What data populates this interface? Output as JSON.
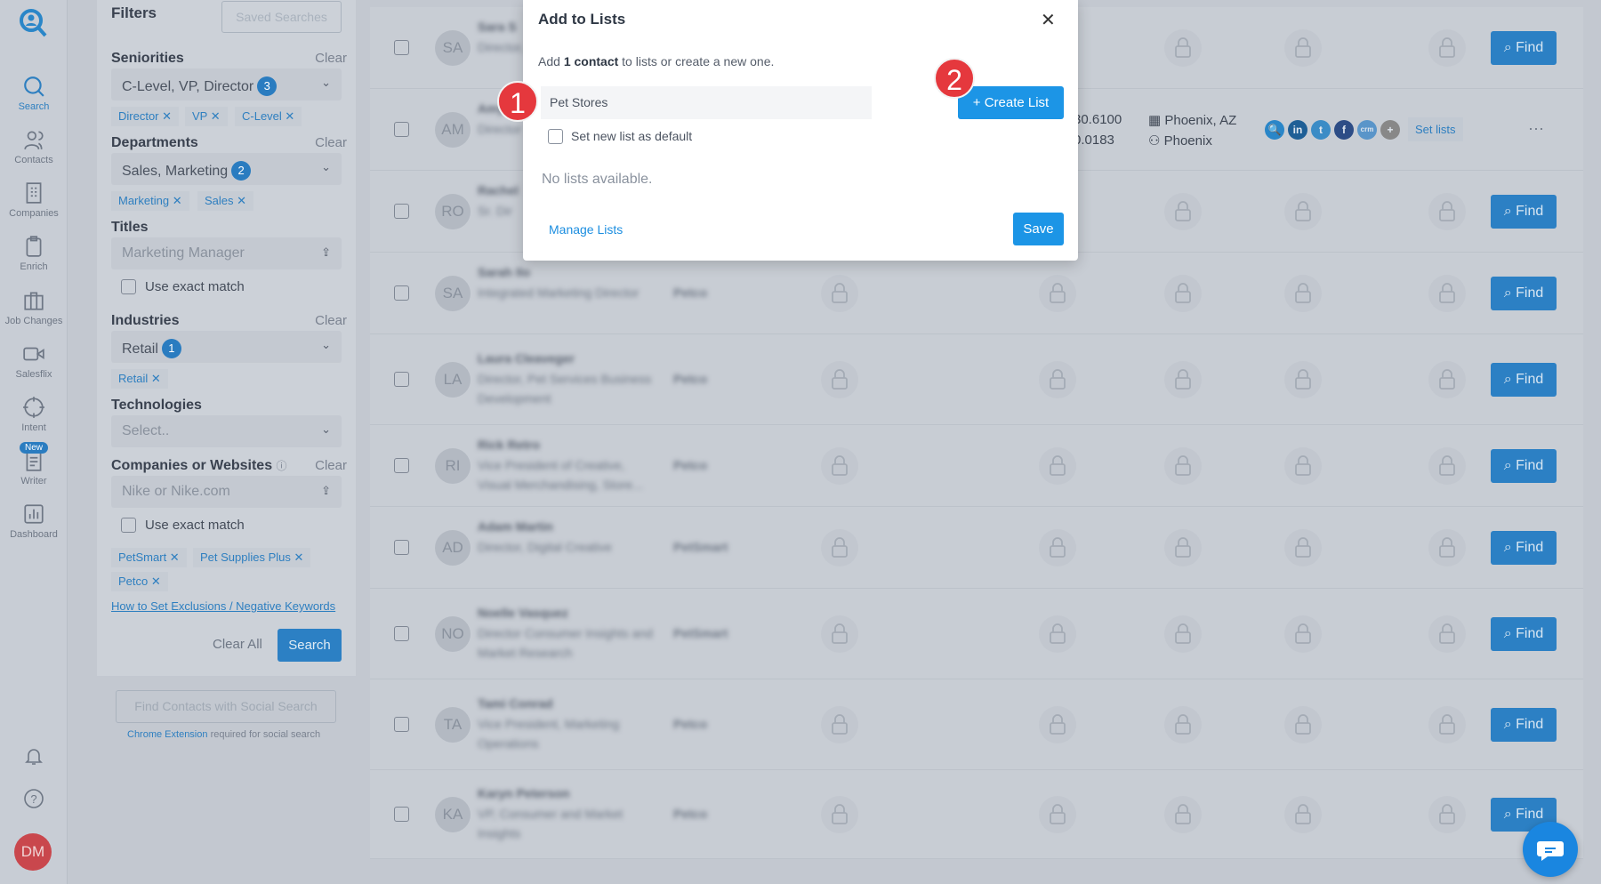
{
  "nav": {
    "items": [
      {
        "label": "Search",
        "icon": "search-icon"
      },
      {
        "label": "Contacts",
        "icon": "contacts-icon"
      },
      {
        "label": "Companies",
        "icon": "building-icon"
      },
      {
        "label": "Enrich",
        "icon": "clipboard-icon"
      },
      {
        "label": "Job Changes",
        "icon": "briefcase-icon"
      },
      {
        "label": "Salesflix",
        "icon": "video-icon"
      },
      {
        "label": "Intent",
        "icon": "crosshair-icon"
      },
      {
        "label": "Writer",
        "icon": "document-icon",
        "badge": "New"
      },
      {
        "label": "Dashboard",
        "icon": "chart-icon"
      }
    ],
    "avatar": "DM"
  },
  "filters": {
    "title": "Filters",
    "saved_searches": "Saved Searches",
    "clear": "Clear",
    "seniorities": {
      "label": "Seniorities",
      "value": "C-Level, VP, Director",
      "count": "3",
      "tags": [
        "Director",
        "VP",
        "C-Level"
      ]
    },
    "departments": {
      "label": "Departments",
      "value": "Sales, Marketing",
      "count": "2",
      "tags": [
        "Marketing",
        "Sales"
      ]
    },
    "titles": {
      "label": "Titles",
      "placeholder": "Marketing Manager",
      "exact": "Use exact match"
    },
    "industries": {
      "label": "Industries",
      "value": "Retail",
      "count": "1",
      "tags": [
        "Retail"
      ]
    },
    "technologies": {
      "label": "Technologies",
      "placeholder": "Select.."
    },
    "companies": {
      "label": "Companies or Websites",
      "placeholder": "Nike or Nike.com",
      "exact": "Use exact match",
      "tags": [
        "PetSmart",
        "Pet Supplies Plus",
        "Petco"
      ]
    },
    "exclusions_link": "How to Set Exclusions / Negative Keywords",
    "clear_all": "Clear All",
    "search": "Search",
    "social_search": "Find Contacts with Social Search",
    "chrome_ext": "Chrome Extension",
    "chrome_note": "required for social search"
  },
  "rows": [
    {
      "initials": "SA",
      "name": "Sara S",
      "title": "Director, ...",
      "company": ""
    },
    {
      "initials": "AM",
      "name": "Amy",
      "title": "Director",
      "company": "",
      "phone1": "30.6100",
      "phone2": "0.0183",
      "location1": "Phoenix, AZ",
      "location2": "Phoenix",
      "set_lists": "Set lists",
      "more": "···"
    },
    {
      "initials": "RO",
      "name": "Rachel",
      "title": "Sr. Dir",
      "company": ""
    },
    {
      "initials": "SA",
      "name": "Sarah Ilo",
      "title": "Integrated Marketing Director",
      "company": "Petco"
    },
    {
      "initials": "LA",
      "name": "Laura Cleaveger",
      "title": "Director, Pet Services Business Development",
      "company": "Petco"
    },
    {
      "initials": "RI",
      "name": "Rick Retro",
      "title": "Vice President of Creative, Visual Merchandising, Store...",
      "company": "Petco"
    },
    {
      "initials": "AD",
      "name": "Adam Martin",
      "title": "Director, Digital Creative",
      "company": "PetSmart"
    },
    {
      "initials": "NO",
      "name": "Noelle Vasquez",
      "title": "Director Consumer Insights and Market Research",
      "company": "PetSmart"
    },
    {
      "initials": "TA",
      "name": "Tami Conrad",
      "title": "Vice President, Marketing Operations",
      "company": "Petco"
    },
    {
      "initials": "KA",
      "name": "Karyn Peterson",
      "title": "VP, Consumer and Market Insights",
      "company": "Petco"
    }
  ],
  "find_label": "Find",
  "modal": {
    "title": "Add to Lists",
    "desc_pre": "Add ",
    "desc_bold": "1 contact",
    "desc_post": " to lists or create a new one.",
    "input_value": "Pet Stores",
    "create": "+ Create List",
    "default_label": "Set new list as default",
    "empty": "No lists available.",
    "manage": "Manage Lists",
    "save": "Save"
  },
  "annotations": [
    "1",
    "2"
  ],
  "colors": {
    "accent": "#1c95e6",
    "annotation": "#e5383d"
  }
}
